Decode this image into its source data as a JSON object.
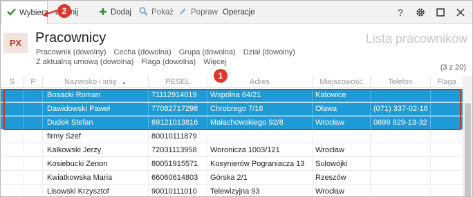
{
  "toolbar": {
    "wybierz": "Wybierz",
    "zamknij": "amknij",
    "dodaj": "Dodaj",
    "pokaz": "Pokaż",
    "popraw": "Popraw",
    "operacje": "Operacje"
  },
  "header": {
    "badge": "PX",
    "title": "Pracownicy",
    "subtitle": "Lista pracowników",
    "filters": [
      "Pracownik (dowolny)",
      "Cecha (dowolna)",
      "Grupa (dowolna)",
      "Dział (dowolny)",
      "Z aktualną umową (dowolna)",
      "Flaga (dowolna)",
      "Więcej"
    ],
    "count": "(3 z 20)"
  },
  "table": {
    "columns": [
      "S",
      "P",
      "Nazwisko i imię",
      "PESEL",
      "Adres",
      "Miejscowość",
      "Telefon",
      "Flaga"
    ],
    "rows": [
      {
        "name": "Bosacki Roman",
        "pesel": "71112914019",
        "adres": "Wspólna 64/21",
        "miejscowosc": "Katowice",
        "telefon": ""
      },
      {
        "name": "Dawidowski Paweł",
        "pesel": "77082717298",
        "adres": "Chrobrego 7/16",
        "miejscowosc": "Oława",
        "telefon": "(071) 337-02-16"
      },
      {
        "name": "Dudek Stefan",
        "pesel": "69121013816",
        "adres": "Małachowskiego 92/8",
        "miejscowosc": "Wrocław",
        "telefon": "0699 929-13-32"
      },
      {
        "name": "firmy Szef",
        "pesel": "80010111879",
        "adres": "",
        "miejscowosc": "",
        "telefon": ""
      },
      {
        "name": "Kalkowski Jerzy",
        "pesel": "72031113958",
        "adres": "Woronicza 1003/121",
        "miejscowosc": "Wrocław",
        "telefon": ""
      },
      {
        "name": "Kosiebucki Zenon",
        "pesel": "80051915571",
        "adres": "Kosynierów Pograniacza 13",
        "miejscowosc": "Sulowójki",
        "telefon": ""
      },
      {
        "name": "Kwiatkowska Maria",
        "pesel": "66060614803",
        "adres": "Górska 2/1",
        "miejscowosc": "Rzeszów",
        "telefon": ""
      },
      {
        "name": "Lisowski Krzysztof",
        "pesel": "90010111010",
        "adres": "Telewizyjna 93",
        "miejscowosc": "Wrocław",
        "telefon": ""
      }
    ]
  },
  "callouts": {
    "one": "1",
    "two": "2"
  },
  "colors": {
    "selection": "#1e9bd6",
    "annotation": "#d93a2b",
    "badge": "#b5392a"
  }
}
